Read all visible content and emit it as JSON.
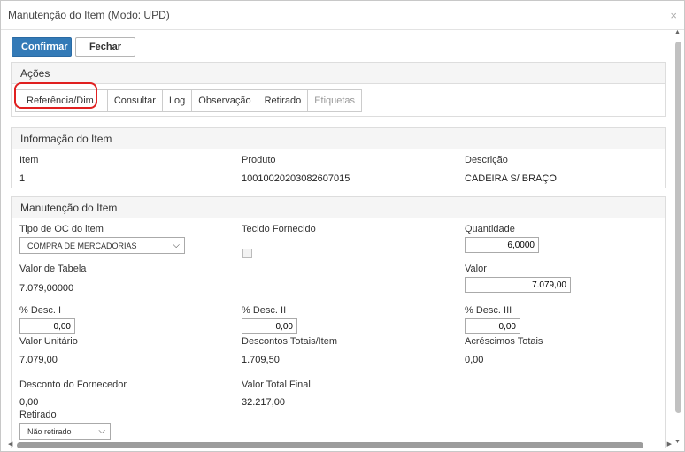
{
  "dialog": {
    "title": "Manutenção do Item (Modo: UPD)",
    "close": "×"
  },
  "toolbar": {
    "confirm_label": "Confirmar",
    "close_label": "Fechar"
  },
  "acoes": {
    "heading": "Ações",
    "tabs": [
      {
        "label": "Referência/Dim.",
        "highlighted": true
      },
      {
        "label": "Consultar"
      },
      {
        "label": "Log"
      },
      {
        "label": "Observação"
      },
      {
        "label": "Retirado"
      },
      {
        "label": "Etiquetas",
        "disabled": true
      }
    ]
  },
  "info": {
    "heading": "Informação do Item",
    "item_label": "Item",
    "item_value": "1",
    "produto_label": "Produto",
    "produto_value": "10010020203082607015",
    "descricao_label": "Descrição",
    "descricao_value": "CADEIRA S/ BRAÇO"
  },
  "manut": {
    "heading": "Manutenção do Item",
    "tipo_oc_label": "Tipo de OC do item",
    "tipo_oc_value": "COMPRA DE MERCADORIAS",
    "tecido_label": "Tecido Fornecido",
    "quantidade_label": "Quantidade",
    "quantidade_value": "6,0000",
    "valor_tabela_label": "Valor de Tabela",
    "valor_tabela_value": "7.079,00000",
    "valor_label": "Valor",
    "valor_value": "7.079,00",
    "desc1_label": "% Desc. I",
    "desc1_value": "0,00",
    "desc2_label": "% Desc. II",
    "desc2_value": "0,00",
    "desc3_label": "% Desc. III",
    "desc3_value": "0,00",
    "valor_unit_label": "Valor Unitário",
    "valor_unit_value": "7.079,00",
    "desc_totais_label": "Descontos Totais/Item",
    "desc_totais_value": "1.709,50",
    "acresc_label": "Acréscimos Totais",
    "acresc_value": "0,00",
    "desc_forn_label": "Desconto do Fornecedor",
    "desc_forn_value": "0,00",
    "total_final_label": "Valor Total Final",
    "total_final_value": "32.217,00",
    "retirado_label": "Retirado",
    "retirado_value": "Não retirado"
  },
  "colors": {
    "primary": "#337ab7",
    "highlight": "#e02020"
  }
}
